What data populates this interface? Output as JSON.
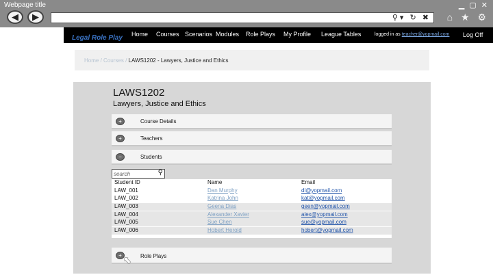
{
  "window": {
    "title": "Webpage title",
    "controls": "▁ ▢ ✕"
  },
  "browser": {
    "back": "◀",
    "forward": "▶",
    "url_icons": "⚲▾ ↻ ✖",
    "tool_icons": "⌂ ★ ⚙"
  },
  "nav": {
    "brand": "Legal Role Play",
    "items": [
      "Home",
      "Courses",
      "Scenarios",
      "Modules",
      "Role Plays",
      "My Profile",
      "League Tables"
    ],
    "logged_prefix": "logged in as",
    "logged_email": "teacher@yopmail.com",
    "logoff": "Log Off"
  },
  "breadcrumb": {
    "home": "Home",
    "sep1": "/",
    "courses": "Courses",
    "sep2": "/",
    "current": "LAWS1202 - Lawyers, Justice and Ethics"
  },
  "course": {
    "code": "LAWS1202",
    "name": "Lawyers, Justice and Ethics"
  },
  "sections": {
    "details": {
      "label": "Course Details",
      "toggle": "+"
    },
    "teachers": {
      "label": "Teachers",
      "toggle": "+"
    },
    "students": {
      "label": "Students",
      "toggle": "−"
    },
    "roleplays": {
      "label": "Role Plays",
      "toggle": "+"
    }
  },
  "search": {
    "placeholder": "search",
    "icon": "⚲"
  },
  "students_table": {
    "headers": {
      "id": "Student ID",
      "name": "Name",
      "email": "Email"
    },
    "rows": [
      {
        "id": "LAW_001",
        "name": "Dan Murphy",
        "email": "dl@yopmail.com"
      },
      {
        "id": "LAW_002",
        "name": "Katrina John",
        "email": "kat@yopmail.com"
      },
      {
        "id": "LAW_003",
        "name": "Geena Dias",
        "email": "geen@yopmail.com"
      },
      {
        "id": "LAW_004",
        "name": "Alexander Xavier",
        "email": "alex@yopmail.com"
      },
      {
        "id": "LAW_005",
        "name": "Sue Chen",
        "email": "sue@yopmail.com"
      },
      {
        "id": "LAW_006",
        "name": "Hobert Herold",
        "email": "hobert@yopmail.com"
      }
    ]
  },
  "cursor_icon": "⬉"
}
